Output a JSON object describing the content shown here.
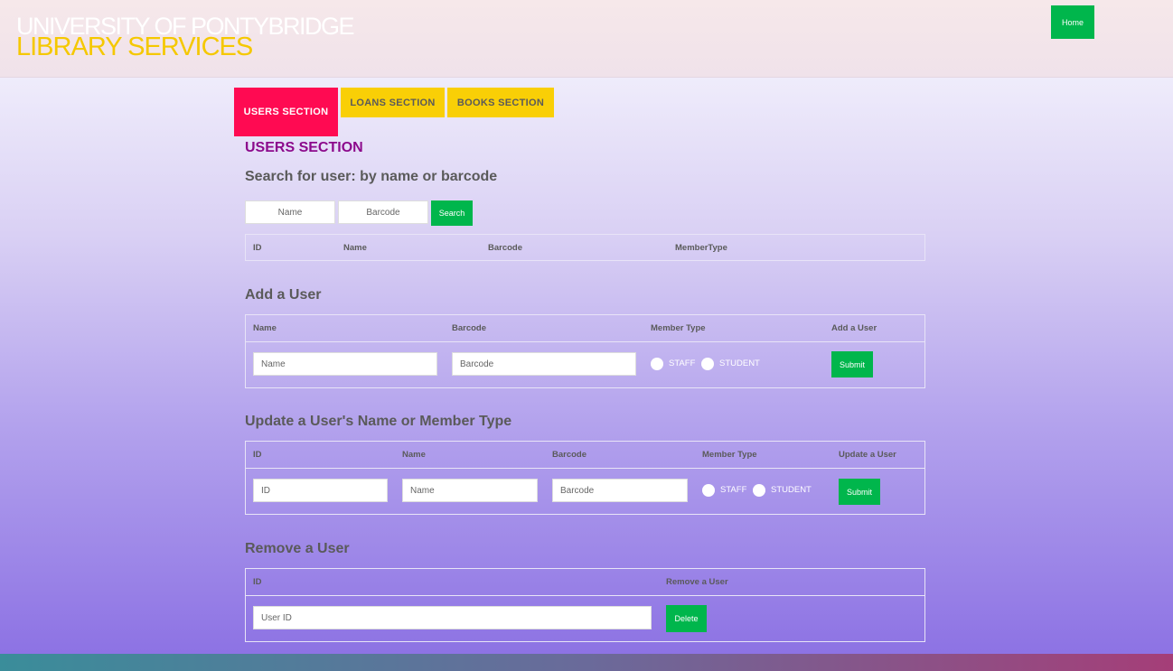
{
  "header": {
    "title_line1": "UNIVERSITY OF PONTYBRIDGE",
    "title_line2": "LIBRARY SERVICES",
    "home_label": "Home"
  },
  "tabs": [
    {
      "label": "USERS SECTION",
      "active": true
    },
    {
      "label": "LOANS SECTION",
      "active": false
    },
    {
      "label": "BOOKS SECTION",
      "active": false
    }
  ],
  "section_title": "USERS SECTION",
  "search": {
    "heading": "Search for user: by name or barcode",
    "name_placeholder": "Name",
    "barcode_placeholder": "Barcode",
    "button_label": "Search",
    "columns": [
      "ID",
      "Name",
      "Barcode",
      "MemberType"
    ]
  },
  "add_user": {
    "heading": "Add a User",
    "columns": [
      "Name",
      "Barcode",
      "Member Type",
      "Add a User"
    ],
    "name_placeholder": "Name",
    "barcode_placeholder": "Barcode",
    "radio_staff": "STAFF",
    "radio_student": "STUDENT",
    "button_label": "Submit"
  },
  "update_user": {
    "heading": "Update a User's Name or Member Type",
    "columns": [
      "ID",
      "Name",
      "Barcode",
      "Member Type",
      "Update a User"
    ],
    "id_placeholder": "ID",
    "name_placeholder": "Name",
    "barcode_placeholder": "Barcode",
    "radio_staff": "STAFF",
    "radio_student": "STUDENT",
    "button_label": "Submit"
  },
  "remove_user": {
    "heading": "Remove a User",
    "columns": [
      "ID",
      "Remove a User"
    ],
    "id_placeholder": "User ID",
    "button_label": "Delete"
  },
  "colors": {
    "accent_green": "#00b64c",
    "active_tab": "#ff0a52",
    "inactive_tab": "#f9cf06",
    "section_title": "#8c0a8c"
  }
}
